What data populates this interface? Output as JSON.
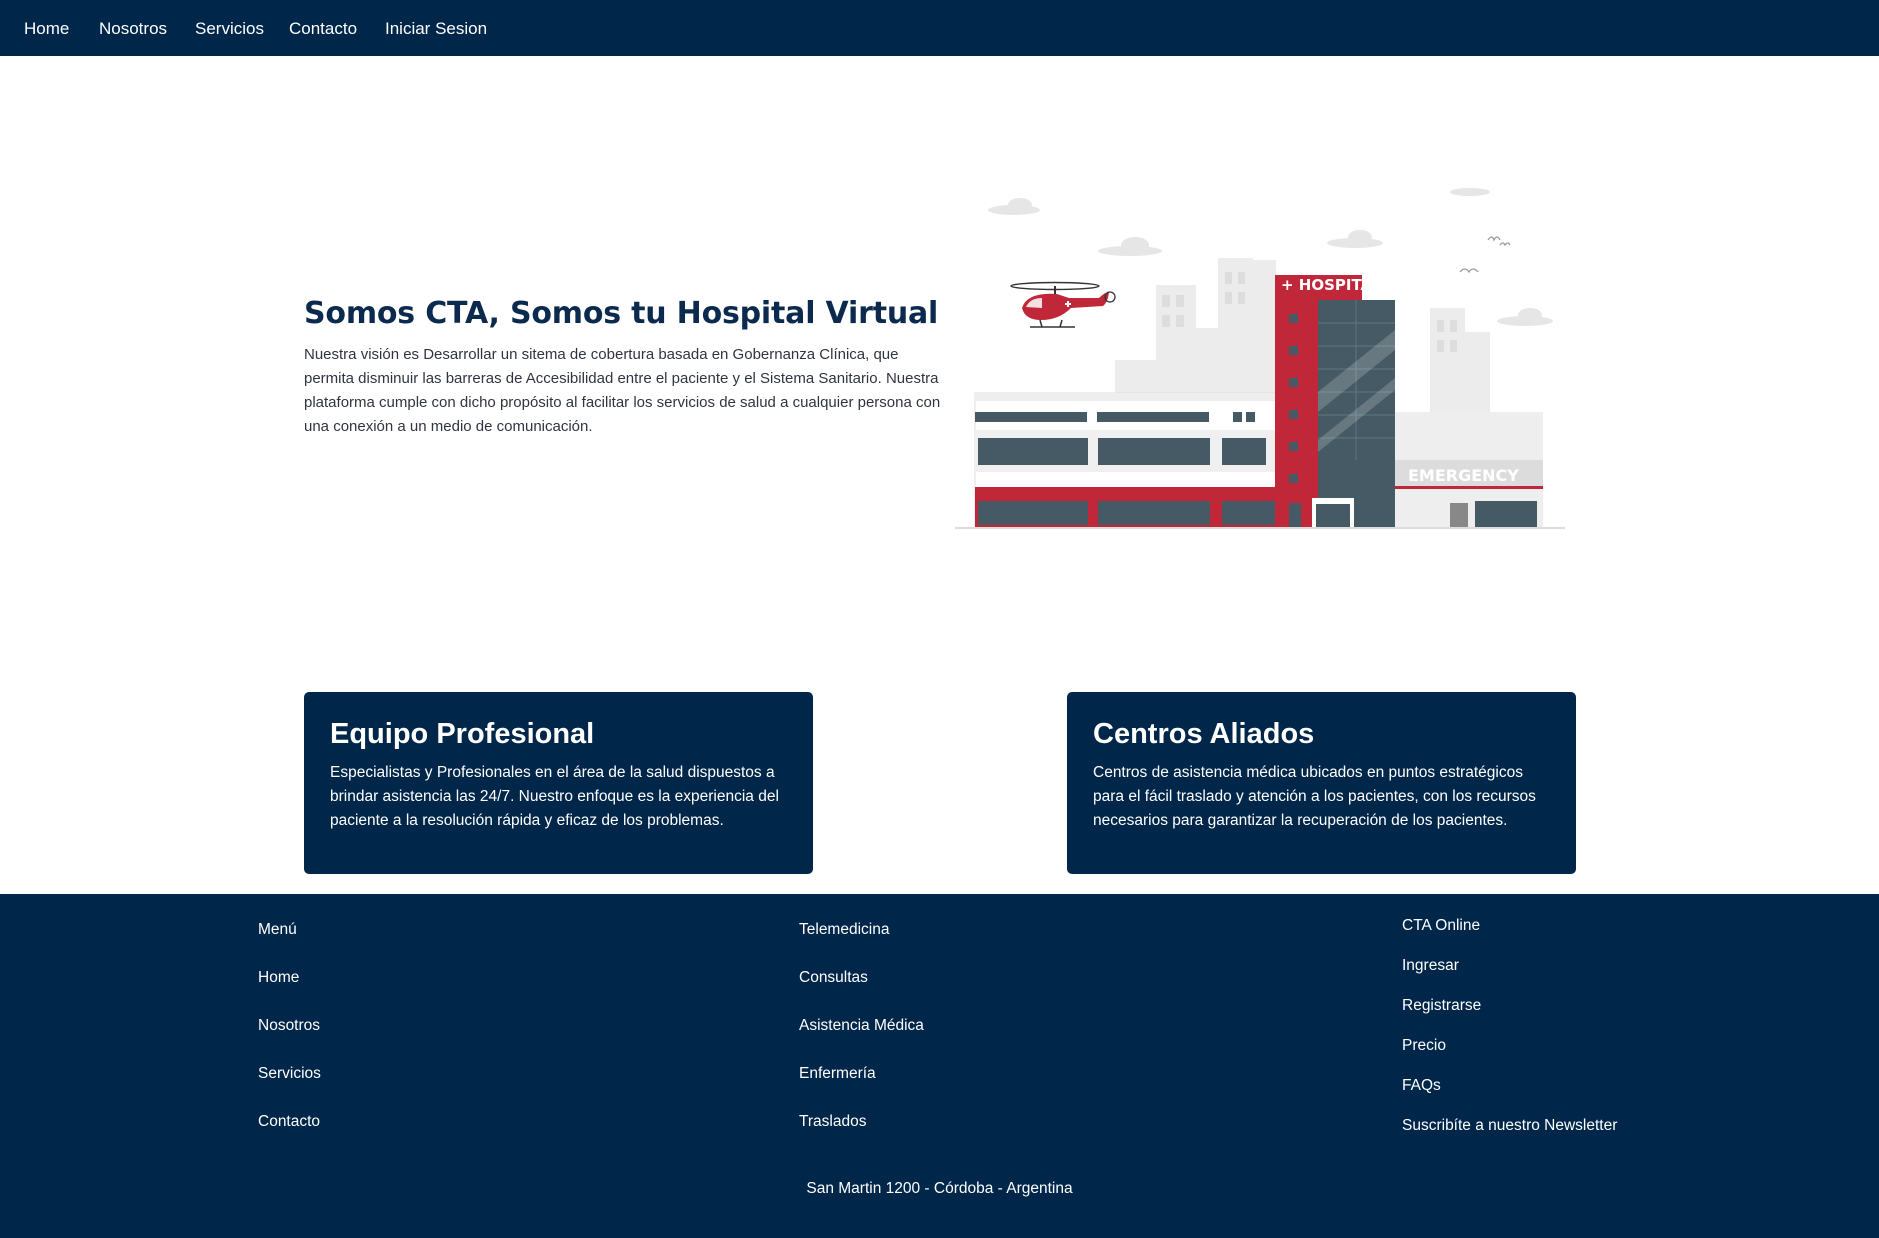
{
  "nav": {
    "items": [
      {
        "label": "Home"
      },
      {
        "label": "Nosotros"
      },
      {
        "label": "Servicios"
      },
      {
        "label": "Contacto"
      },
      {
        "label": "Iniciar Sesion"
      }
    ]
  },
  "hero": {
    "title": "Somos CTA, Somos tu Hospital Virtual",
    "text": "Nuestra visión es Desarrollar un sitema de cobertura basada en Gobernanza Clínica, que permita disminuir las barreras de Accesibilidad entre el paciente y el Sistema Sanitario. Nuestra plataforma cumple con dicho propósito al facilitar los servicios de salud a cualquier persona con una conexión a un medio de comunicación.",
    "illustration": {
      "hospital_sign": "+ HOSPITAL",
      "emergency_sign": "EMERGENCY"
    }
  },
  "cards": [
    {
      "title": "Equipo Profesional",
      "text": "Especialistas y Profesionales en el área de la salud dispuestos a brindar asistencia las 24/7. Nuestro enfoque es la experiencia del paciente a la resolución rápida y eficaz de los problemas."
    },
    {
      "title": "Centros Aliados",
      "text": "Centros de asistencia médica ubicados en puntos estratégicos para el fácil traslado y atención a los pacientes, con los recursos necesarios para garantizar la recuperación de los pacientes."
    }
  ],
  "footer": {
    "col1": [
      "Menú",
      "Home",
      "Nosotros",
      "Servicios",
      "Contacto"
    ],
    "col2": [
      "Telemedicina",
      "Consultas",
      "Asistencia Médica",
      "Enfermería",
      "Traslados"
    ],
    "col3": [
      "CTA Online",
      "Ingresar",
      "Registrarse",
      "Precio",
      "FAQs",
      "Suscribíte a nuestro Newsletter"
    ],
    "address": "San Martin 1200 - Córdoba - Argentina"
  },
  "colors": {
    "navy": "#00264a",
    "hospital_red": "#c0283a",
    "white": "#ffffff"
  }
}
